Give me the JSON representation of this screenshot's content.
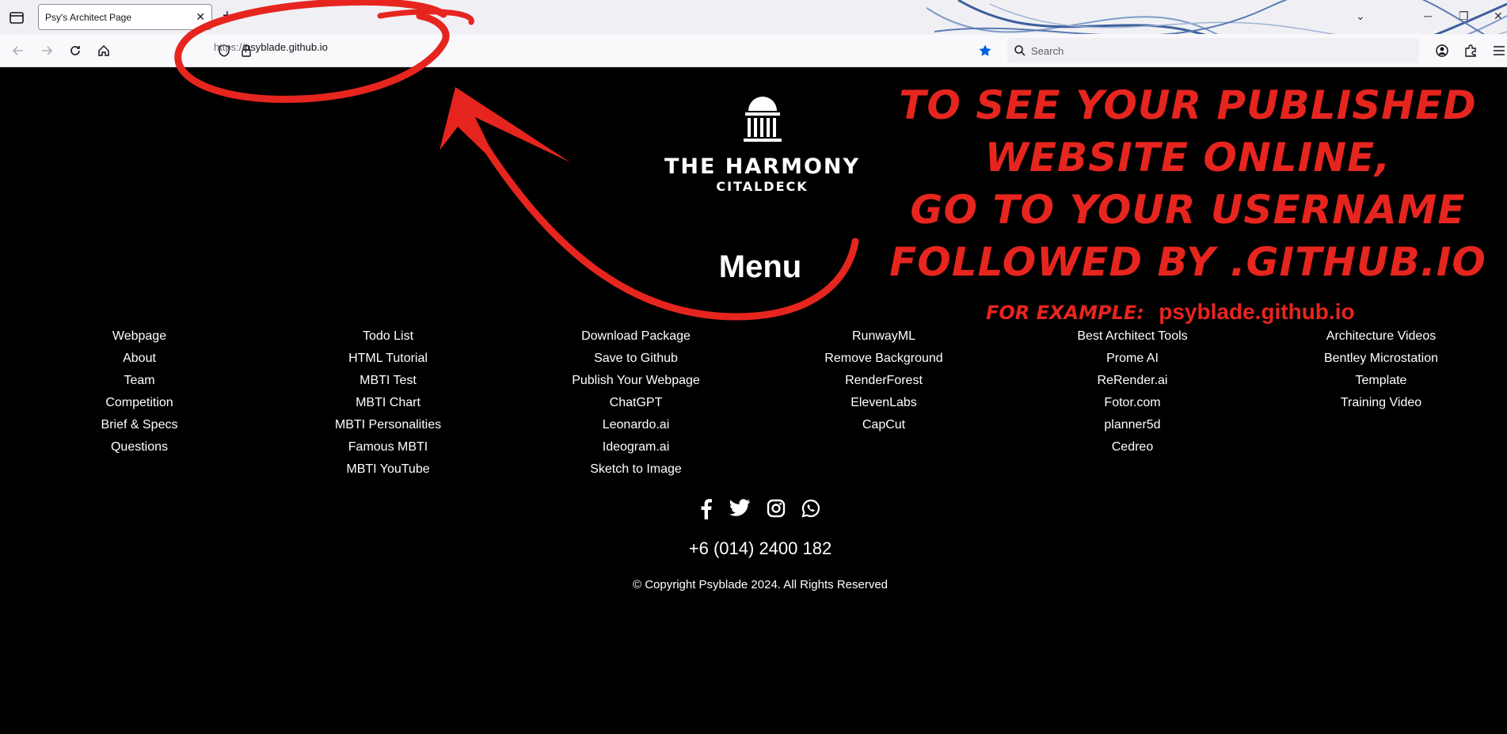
{
  "browser": {
    "tab_title": "Psy's Architect Page",
    "tab_close": "✕",
    "new_tab": "+",
    "url_prefix": "https://",
    "url_host": "psyblade.github.io",
    "search_placeholder": "Search",
    "window_controls": [
      "─",
      "❐",
      "✕"
    ]
  },
  "site": {
    "logo_title": "THE HARMONY",
    "logo_sub": "CITALDECK",
    "menu_title": "Menu",
    "menu_columns": [
      [
        "Webpage",
        "About",
        "Team",
        "Competition",
        "Brief & Specs",
        "Questions"
      ],
      [
        "Todo List",
        "HTML Tutorial",
        "MBTI Test",
        "MBTI Chart",
        "MBTI Personalities",
        "Famous MBTI",
        "MBTI YouTube"
      ],
      [
        "Download Package",
        "Save to Github",
        "Publish Your Webpage",
        "ChatGPT",
        "Leonardo.ai",
        "Ideogram.ai",
        "Sketch to Image"
      ],
      [
        "RunwayML",
        "Remove Background",
        "RenderForest",
        "ElevenLabs",
        "CapCut"
      ],
      [
        "Best Architect Tools",
        "Prome AI",
        "ReRender.ai",
        "Fotor.com",
        "planner5d",
        "Cedreo"
      ],
      [
        "Architecture Videos",
        "Bentley Microstation",
        "Template",
        "Training Video"
      ]
    ],
    "social_icons": [
      "facebook-icon",
      "twitter-icon",
      "instagram-icon",
      "whatsapp-icon"
    ],
    "phone": "+6 (014) 2400 182",
    "copyright": "© Copyright Psyblade 2024. All Rights Reserved"
  },
  "annotation": {
    "line1": "To see your published",
    "line2": "website online,",
    "line3": "Go to your username",
    "line4": "followed by .github.io",
    "example_label": "For example:",
    "example_value": "psyblade.github.io",
    "color": "#e6251f"
  }
}
